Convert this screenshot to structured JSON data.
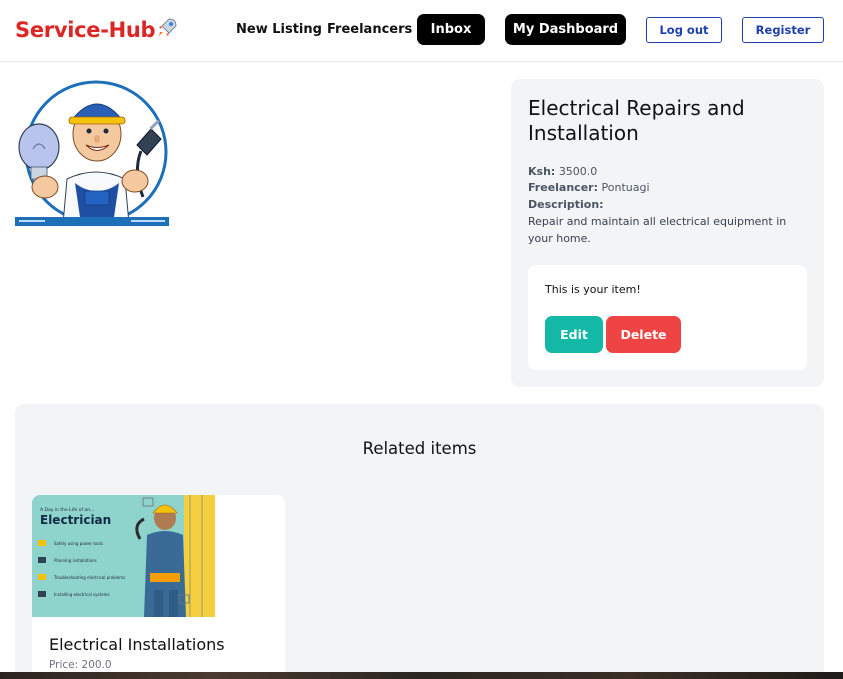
{
  "header": {
    "brand": "Service-Hub",
    "brand_icon": "rocket-icon",
    "nav": {
      "new_listing": "New Listing",
      "freelancers": "Freelancers",
      "inbox": "Inbox",
      "dashboard": "My Dashboard",
      "logout": "Log out",
      "register": "Register"
    }
  },
  "listing": {
    "title": "Electrical Repairs and Installation",
    "price_label": "Ksh:",
    "price": "3500.0",
    "freelancer_label": "Freelancer:",
    "freelancer": "Pontuagi",
    "description_label": "Description:",
    "description": "Repair and maintain all electrical equipment in your home.",
    "owner_note": "This is your item!",
    "edit_label": "Edit",
    "delete_label": "Delete"
  },
  "related": {
    "title": "Related items",
    "items": [
      {
        "name": "Electrical Installations",
        "price_text": "Price: 200.0",
        "image_heading": "Electrician",
        "image_kicker": "A Day in the Life of an...",
        "image_bullets": [
          "Safely using power tools",
          "Planning installations",
          "Troubleshooting electrical problems",
          "Installing electrical systems"
        ]
      }
    ]
  },
  "colors": {
    "brand": "#dc2626",
    "edit": "#14b8a6",
    "delete": "#ef4444",
    "outline": "#1e40af"
  }
}
